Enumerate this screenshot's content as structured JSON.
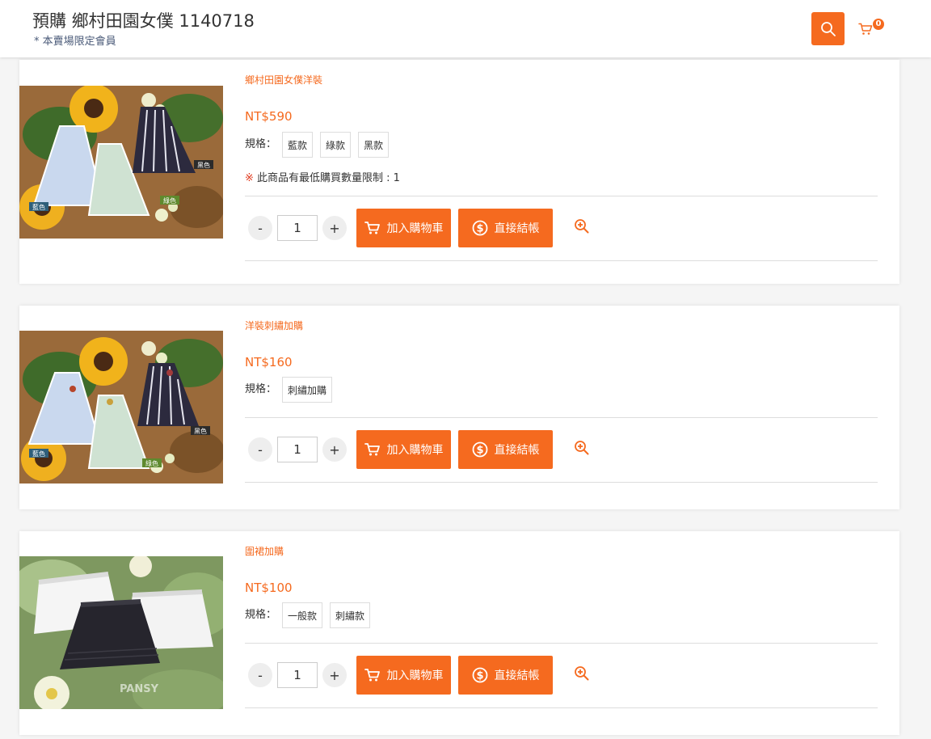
{
  "header": {
    "title": "預購 鄉村田園女僕 1140718",
    "subtitle": "* 本賣場限定會員",
    "search_icon": "search-icon",
    "cart_icon": "cart-icon",
    "cart_count": "0"
  },
  "colors": {
    "accent": "#f56a1f",
    "limit_mark": "#e0391d"
  },
  "products": [
    {
      "name": "鄉村田園女僕洋裝",
      "price": "NT$590",
      "spec_label": "規格：",
      "specs": [
        "藍款",
        "綠款",
        "黑款"
      ],
      "limit_mark": "※",
      "limit_text": " 此商品有最低購買數量限制 : 1",
      "qty": "1",
      "minus": "-",
      "plus": "+",
      "add_cart": "加入購物車",
      "buy_now": "直接結帳",
      "image_tags": [
        "黑色",
        "綠色",
        "藍色"
      ]
    },
    {
      "name": "洋裝刺繡加購",
      "price": "NT$160",
      "spec_label": "規格：",
      "specs": [
        "刺繡加購"
      ],
      "qty": "1",
      "minus": "-",
      "plus": "+",
      "add_cart": "加入購物車",
      "buy_now": "直接結帳",
      "image_tags": [
        "黑色",
        "綠色",
        "藍色"
      ]
    },
    {
      "name": "圍裙加購",
      "price": "NT$100",
      "spec_label": "規格：",
      "specs": [
        "一般款",
        "刺繡款"
      ],
      "qty": "1",
      "minus": "-",
      "plus": "+",
      "add_cart": "加入購物車",
      "buy_now": "直接結帳",
      "image_watermark": "PANSY"
    }
  ]
}
